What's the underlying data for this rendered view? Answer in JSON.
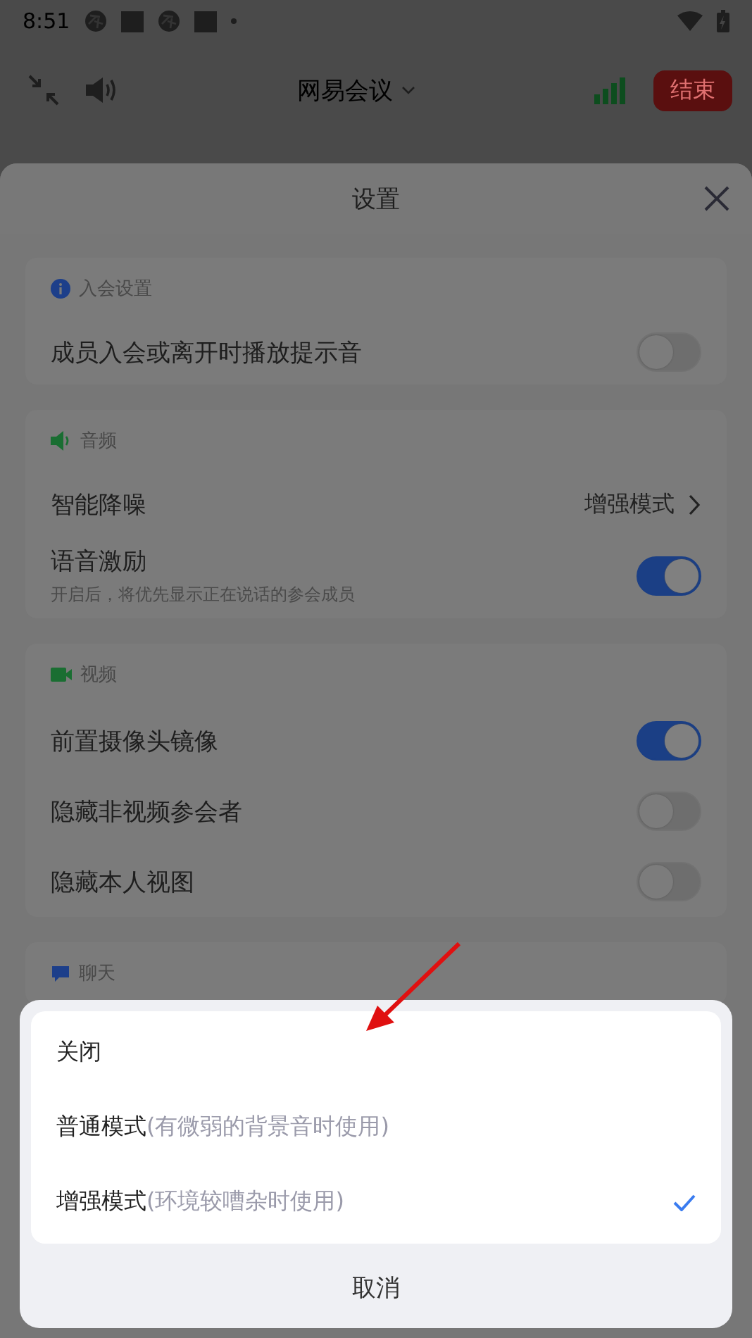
{
  "status_bar": {
    "time": "8:51"
  },
  "top_bar": {
    "title": "网易会议",
    "end_button": "结束"
  },
  "settings": {
    "title": "设置",
    "sections": [
      {
        "kind": "info",
        "title": "入会设置",
        "rows": [
          {
            "kind": "toggle",
            "label": "成员入会或离开时播放提示音",
            "on": false
          }
        ]
      },
      {
        "kind": "audio",
        "title": "音频",
        "rows": [
          {
            "kind": "value",
            "label": "智能降噪",
            "value": "增强模式"
          },
          {
            "kind": "toggle",
            "label": "语音激励",
            "subtitle": "开启后，将优先显示正在说话的参会成员",
            "on": true
          }
        ]
      },
      {
        "kind": "video",
        "title": "视频",
        "rows": [
          {
            "kind": "toggle",
            "label": "前置摄像头镜像",
            "on": true
          },
          {
            "kind": "toggle",
            "label": "隐藏非视频参会者",
            "on": false
          },
          {
            "kind": "toggle",
            "label": "隐藏本人视图",
            "on": false
          }
        ]
      },
      {
        "kind": "chat",
        "title": "聊天"
      }
    ]
  },
  "noise_sheet": {
    "options": [
      {
        "label": "关闭",
        "selected": false
      },
      {
        "label": "普通模式",
        "hint": "(有微弱的背景音时使用)",
        "selected": false
      },
      {
        "label": "增强模式",
        "hint": "(环境较嘈杂时使用)",
        "selected": true
      }
    ],
    "cancel": "取消"
  }
}
